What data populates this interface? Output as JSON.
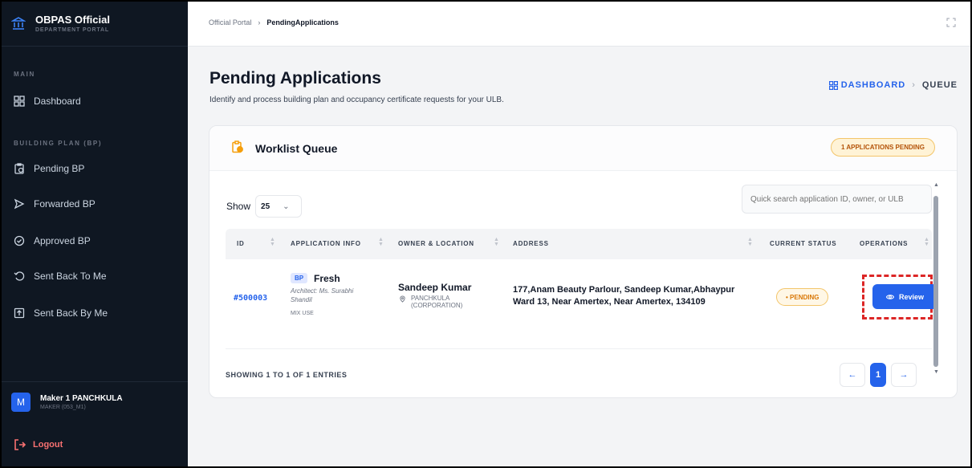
{
  "brand": {
    "title": "OBPAS Official",
    "subtitle": "DEPARTMENT PORTAL",
    "icon": "bank-icon"
  },
  "sidebar": {
    "sections": [
      {
        "label": "MAIN",
        "items": [
          {
            "label": "Dashboard",
            "icon": "grid-icon"
          }
        ]
      },
      {
        "label": "BUILDING PLAN (BP)",
        "items": [
          {
            "label": "Pending BP",
            "icon": "clipboard-clock-icon"
          },
          {
            "label": "Forwarded BP",
            "icon": "send-icon"
          },
          {
            "label": "Approved BP",
            "icon": "check-circle-icon"
          },
          {
            "label": "Sent Back To Me",
            "icon": "undo-icon"
          },
          {
            "label": "Sent Back By Me",
            "icon": "upload-box-icon"
          }
        ]
      }
    ]
  },
  "user": {
    "initial": "M",
    "name": "Maker 1 PANCHKULA",
    "role": "MAKER (053_M1)"
  },
  "logout_label": "Logout",
  "topbar": {
    "crumb_root": "Official Portal",
    "crumb_current": "PendingApplications"
  },
  "page": {
    "title": "Pending Applications",
    "subtitle": "Identify and process building plan and occupancy certificate requests for your ULB.",
    "right_crumb": {
      "dashboard": "DASHBOARD",
      "separator": "›",
      "queue": "QUEUE"
    }
  },
  "card": {
    "title": "Worklist Queue",
    "badge": "1 APPLICATIONS PENDING",
    "show_label": "Show",
    "page_size": "25",
    "search_placeholder": "Quick search application ID, owner, or ULB",
    "columns": [
      "ID",
      "APPLICATION INFO",
      "OWNER & LOCATION",
      "ADDRESS",
      "CURRENT STATUS",
      "OPERATIONS"
    ],
    "rows": [
      {
        "id": "#500003",
        "tag": "BP",
        "type": "Fresh",
        "architect": "Architect: Ms. Surabhi Shandil",
        "use": "MIX USE",
        "owner": "Sandeep Kumar",
        "location": "PANCHKULA (CORPORATION)",
        "address": "177,Anam Beauty Parlour, Sandeep Kumar,Abhaypur Ward 13, Near Amertex, Near Amertex, 134109",
        "status": "PENDING",
        "action": "Review"
      }
    ],
    "entries": "SHOWING 1 TO 1 OF 1 ENTRIES",
    "pager": {
      "prev": "←",
      "current": "1",
      "next": "→"
    }
  },
  "colors": {
    "sidebar_bg": "#0f1722",
    "accent": "#2563eb",
    "pending": "#d97706",
    "highlight": "#dc2626"
  }
}
